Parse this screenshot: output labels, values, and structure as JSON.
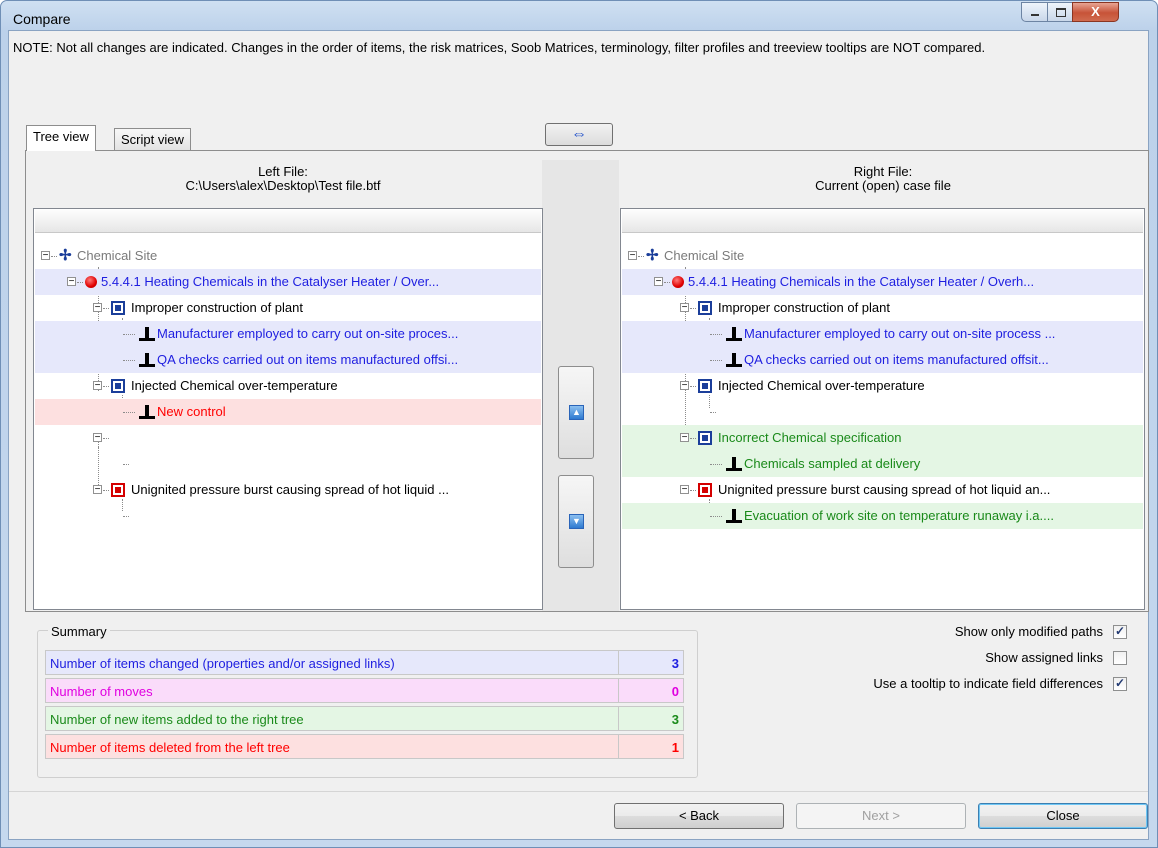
{
  "window": {
    "title": "Compare",
    "close_glyph": "X"
  },
  "note": "NOTE: Not all changes are indicated. Changes in the order of items, the risk matrices, Soob Matrices, terminology, filter profiles and treeview tooltips are NOT compared.",
  "tabs": [
    {
      "label": "Tree view",
      "active": true
    },
    {
      "label": "Script view",
      "active": false
    }
  ],
  "swap_button": {
    "icon": "swap-arrows-icon",
    "glyph": "⇔"
  },
  "left": {
    "header_line1": "Left File:",
    "header_line2": "C:\\Users\\alex\\Desktop\\Test file.btf",
    "rows": [
      {
        "text": "Chemical Site",
        "icon": "site-icon",
        "color": "grey"
      },
      {
        "text": "5.4.4.1 Heating Chemicals in the Catalyser Heater / Over...",
        "icon": "hazard-icon",
        "color": "blue"
      },
      {
        "text": "Improper construction of plant",
        "icon": "threat-icon",
        "color": "black"
      },
      {
        "text": "Manufacturer employed to carry out on-site proces...",
        "icon": "control-icon",
        "color": "blue"
      },
      {
        "text": "QA checks carried out on items manufactured offsi...",
        "icon": "control-icon",
        "color": "blue"
      },
      {
        "text": "Injected Chemical over-temperature",
        "icon": "threat-icon",
        "color": "black"
      },
      {
        "text": "New control",
        "icon": "control-icon",
        "color": "red"
      },
      {
        "text": "",
        "icon": "",
        "color": "black"
      },
      {
        "text": "",
        "icon": "",
        "color": "black"
      },
      {
        "text": "Unignited pressure burst causing spread of hot liquid ...",
        "icon": "threat-icon-red",
        "color": "black"
      },
      {
        "text": "",
        "icon": "",
        "color": "black"
      }
    ]
  },
  "right": {
    "header_line1": "Right File:",
    "header_line2": "Current (open) case file",
    "rows": [
      {
        "text": "Chemical Site",
        "icon": "site-icon",
        "color": "grey"
      },
      {
        "text": "5.4.4.1 Heating Chemicals in the Catalyser Heater / Overh...",
        "icon": "hazard-icon",
        "color": "blue"
      },
      {
        "text": "Improper construction of plant",
        "icon": "threat-icon",
        "color": "black"
      },
      {
        "text": "Manufacturer employed to carry out on-site process ...",
        "icon": "control-icon",
        "color": "blue"
      },
      {
        "text": "QA checks carried out on items manufactured offsit...",
        "icon": "control-icon",
        "color": "blue"
      },
      {
        "text": "Injected Chemical over-temperature",
        "icon": "threat-icon",
        "color": "black"
      },
      {
        "text": "",
        "icon": "",
        "color": "black"
      },
      {
        "text": "Incorrect Chemical specification",
        "icon": "threat-icon",
        "color": "green"
      },
      {
        "text": "Chemicals sampled at delivery",
        "icon": "control-icon",
        "color": "green"
      },
      {
        "text": "Unignited pressure burst causing spread of hot liquid an...",
        "icon": "threat-icon-red",
        "color": "black"
      },
      {
        "text": "Evacuation of work site on temperature runaway i.a....",
        "icon": "control-icon",
        "color": "green"
      }
    ]
  },
  "nav_buttons": {
    "up_icon": "arrow-up-icon",
    "down_icon": "arrow-down-icon",
    "up_glyph": "▲",
    "down_glyph": "▼"
  },
  "summary": {
    "title": "Summary",
    "rows": [
      {
        "label": "Number of items changed (properties and/or assigned links)",
        "value": "3",
        "color": "#1e1ee0",
        "bg": "#e6e8fb"
      },
      {
        "label": "Number of moves",
        "value": "0",
        "color": "#e000e0",
        "bg": "#fadcfa"
      },
      {
        "label": "Number of new items added to the right tree",
        "value": "3",
        "color": "#1a8a1a",
        "bg": "#e4f6e4"
      },
      {
        "label": "Number of items deleted from the left tree",
        "value": "1",
        "color": "#ff0000",
        "bg": "#fde0e0"
      }
    ]
  },
  "options": [
    {
      "label": "Show only modified paths",
      "checked": true
    },
    {
      "label": "Show assigned links",
      "checked": false
    },
    {
      "label": "Use a tooltip to indicate field differences",
      "checked": true
    }
  ],
  "buttons": {
    "back": "< Back",
    "next": "Next >",
    "close": "Close"
  }
}
